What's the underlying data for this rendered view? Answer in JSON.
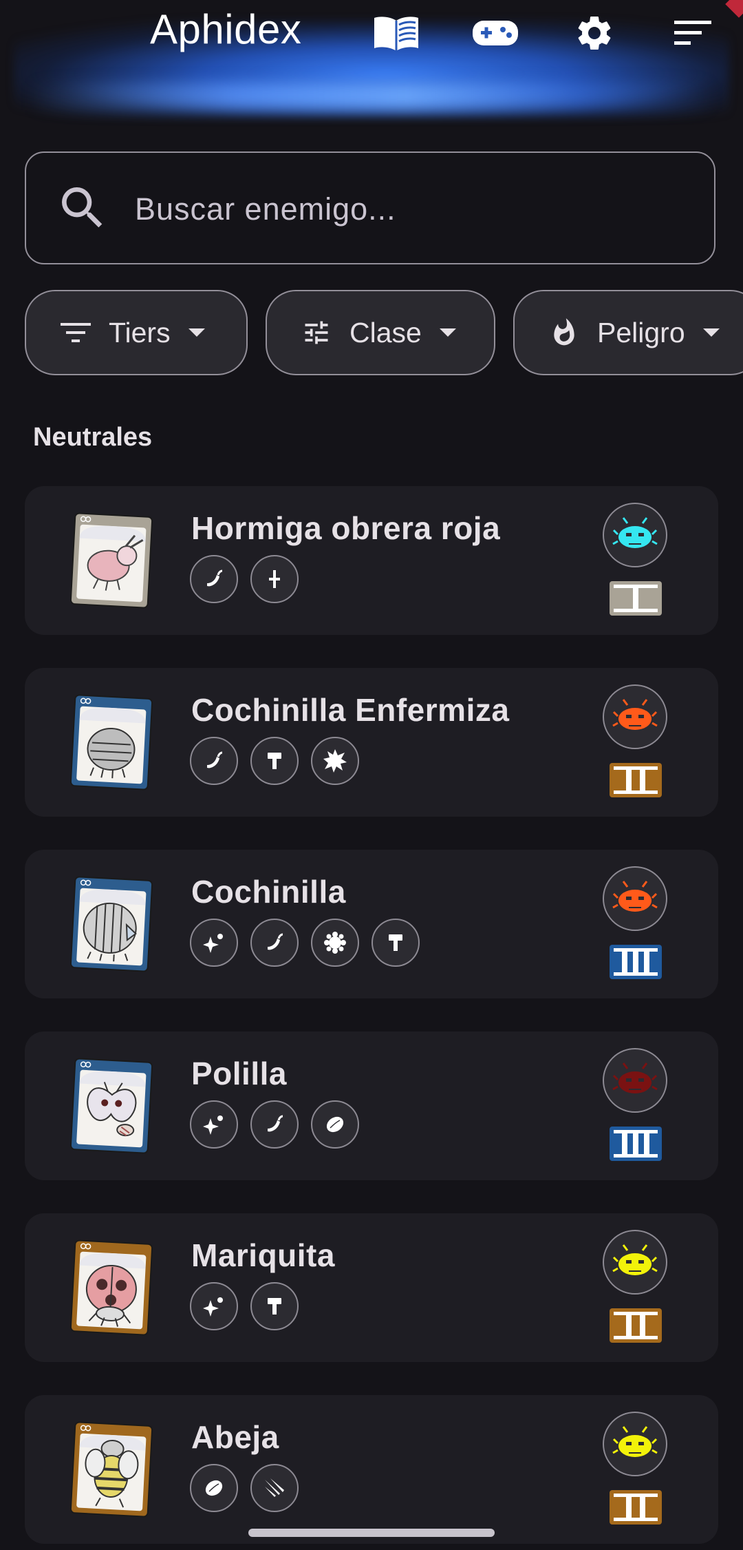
{
  "header": {
    "title": "Aphidex",
    "icons": [
      "book-icon",
      "gamepad-icon",
      "gear-icon",
      "sort-icon"
    ],
    "accent": "#3a84ff"
  },
  "search": {
    "placeholder": "Buscar enemigo...",
    "value": ""
  },
  "filters": [
    {
      "label": "Tiers",
      "icon": "filter-list-icon"
    },
    {
      "label": "Clase",
      "icon": "tune-icon"
    },
    {
      "label": "Peligro",
      "icon": "fire-icon"
    }
  ],
  "section": {
    "title": "Neutrales"
  },
  "enemies": [
    {
      "name": "Hormiga obrera roja",
      "tags": [
        "pepper-icon",
        "dagger-icon"
      ],
      "danger_color": "#35e6f0",
      "tier": "I",
      "tier_color": "#a9a396"
    },
    {
      "name": "Cochinilla Enfermiza",
      "tags": [
        "pepper-icon",
        "hammer-icon",
        "burst-icon"
      ],
      "danger_color": "#ff5a1a",
      "tier": "II",
      "tier_color": "#a56a1c"
    },
    {
      "name": "Cochinilla",
      "tags": [
        "sparkle-icon",
        "pepper-icon",
        "splat-icon",
        "hammer-icon"
      ],
      "danger_color": "#ff5a1a",
      "tier": "III",
      "tier_color": "#1f5a9e"
    },
    {
      "name": "Polilla",
      "tags": [
        "sparkle-icon",
        "pepper-icon",
        "lemon-icon"
      ],
      "danger_color": "#7a1212",
      "tier": "III",
      "tier_color": "#1f5a9e"
    },
    {
      "name": "Mariquita",
      "tags": [
        "sparkle-icon",
        "hammer-icon"
      ],
      "danger_color": "#f2f20a",
      "tier": "II",
      "tier_color": "#a56a1c"
    },
    {
      "name": "Abeja",
      "tags": [
        "lemon-icon",
        "claw-icon"
      ],
      "danger_color": "#f2f20a",
      "tier": "II",
      "tier_color": "#a56a1c"
    }
  ]
}
